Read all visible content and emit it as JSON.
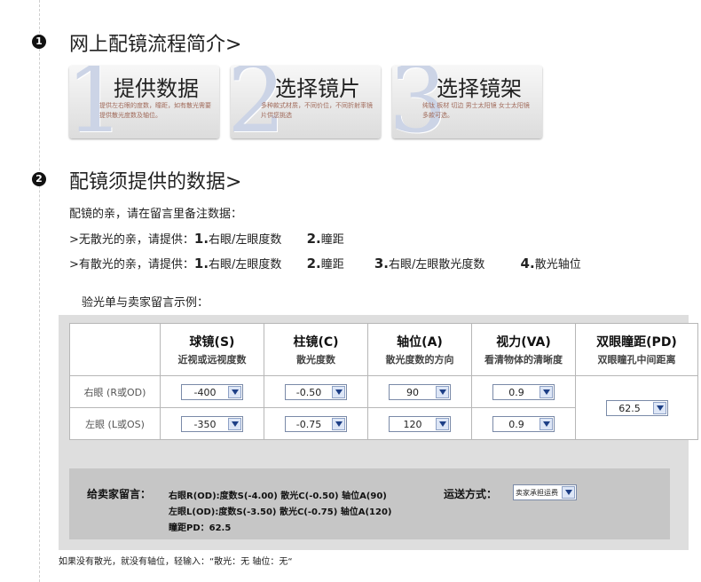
{
  "section1": {
    "num": "1",
    "title": "网上配镜流程简介>"
  },
  "steps": [
    {
      "num": "1",
      "title": "提供数据",
      "desc": "提供左右眼的度数，瞳距，如有散光需要提供散光度数及轴位。"
    },
    {
      "num": "2",
      "title": "选择镜片",
      "desc": "多种款式材质，不同价位，不同折射率镜片供您挑选"
    },
    {
      "num": "3",
      "title": "选择镜架",
      "desc": "纯钛 板材 切边 男士太阳镜 女士太阳镜 多款可选。"
    }
  ],
  "section2": {
    "num": "2",
    "title": "配镜须提供的数据>"
  },
  "intro": "配镜的亲，请在留言里备注数据：",
  "no_astig": {
    "prefix": ">无散光的亲，请提供：",
    "i1n": "1.",
    "i1": "右眼/左眼度数",
    "i2n": "2.",
    "i2": "瞳距"
  },
  "with_astig": {
    "prefix": ">有散光的亲，请提供：",
    "i1n": "1.",
    "i1": "右眼/左眼度数",
    "i2n": "2.",
    "i2": "瞳距",
    "i3n": "3.",
    "i3": "右眼/左眼散光度数",
    "i4n": "4.",
    "i4": "散光轴位"
  },
  "example_title": "验光单与卖家留言示例：",
  "table": {
    "headers": [
      {
        "t1": "球镜(S)",
        "t2": "近视或远视度数"
      },
      {
        "t1": "柱镜(C)",
        "t2": "散光度数"
      },
      {
        "t1": "轴位(A)",
        "t2": "散光度数的方向"
      },
      {
        "t1": "视力(VA)",
        "t2": "看清物体的清晰度"
      },
      {
        "t1": "双眼瞳距(PD)",
        "t2": "双眼瞳孔中间距离"
      }
    ],
    "rows": [
      {
        "label": "右眼 (R或OD)",
        "s": "-400",
        "c": "-0.50",
        "a": "90",
        "va": "0.9"
      },
      {
        "label": "左眼 (L或OS)",
        "s": "-350",
        "c": "-0.75",
        "a": "120",
        "va": "0.9"
      }
    ],
    "pd": "62.5"
  },
  "note": {
    "label": "给卖家留言：",
    "line1": "右眼R(OD):度数S(-4.00) 散光C(-0.50) 轴位A(90)",
    "line2": "左眼L(OD):度数S(-3.50) 散光C(-0.75) 轴位A(120)",
    "line3": "瞳距PD：62.5",
    "ship_label": "运送方式：",
    "ship_value": "卖家承担运费"
  },
  "footer": "如果没有散光，就没有轴位，轻输入：“散光：无 轴位：无“"
}
